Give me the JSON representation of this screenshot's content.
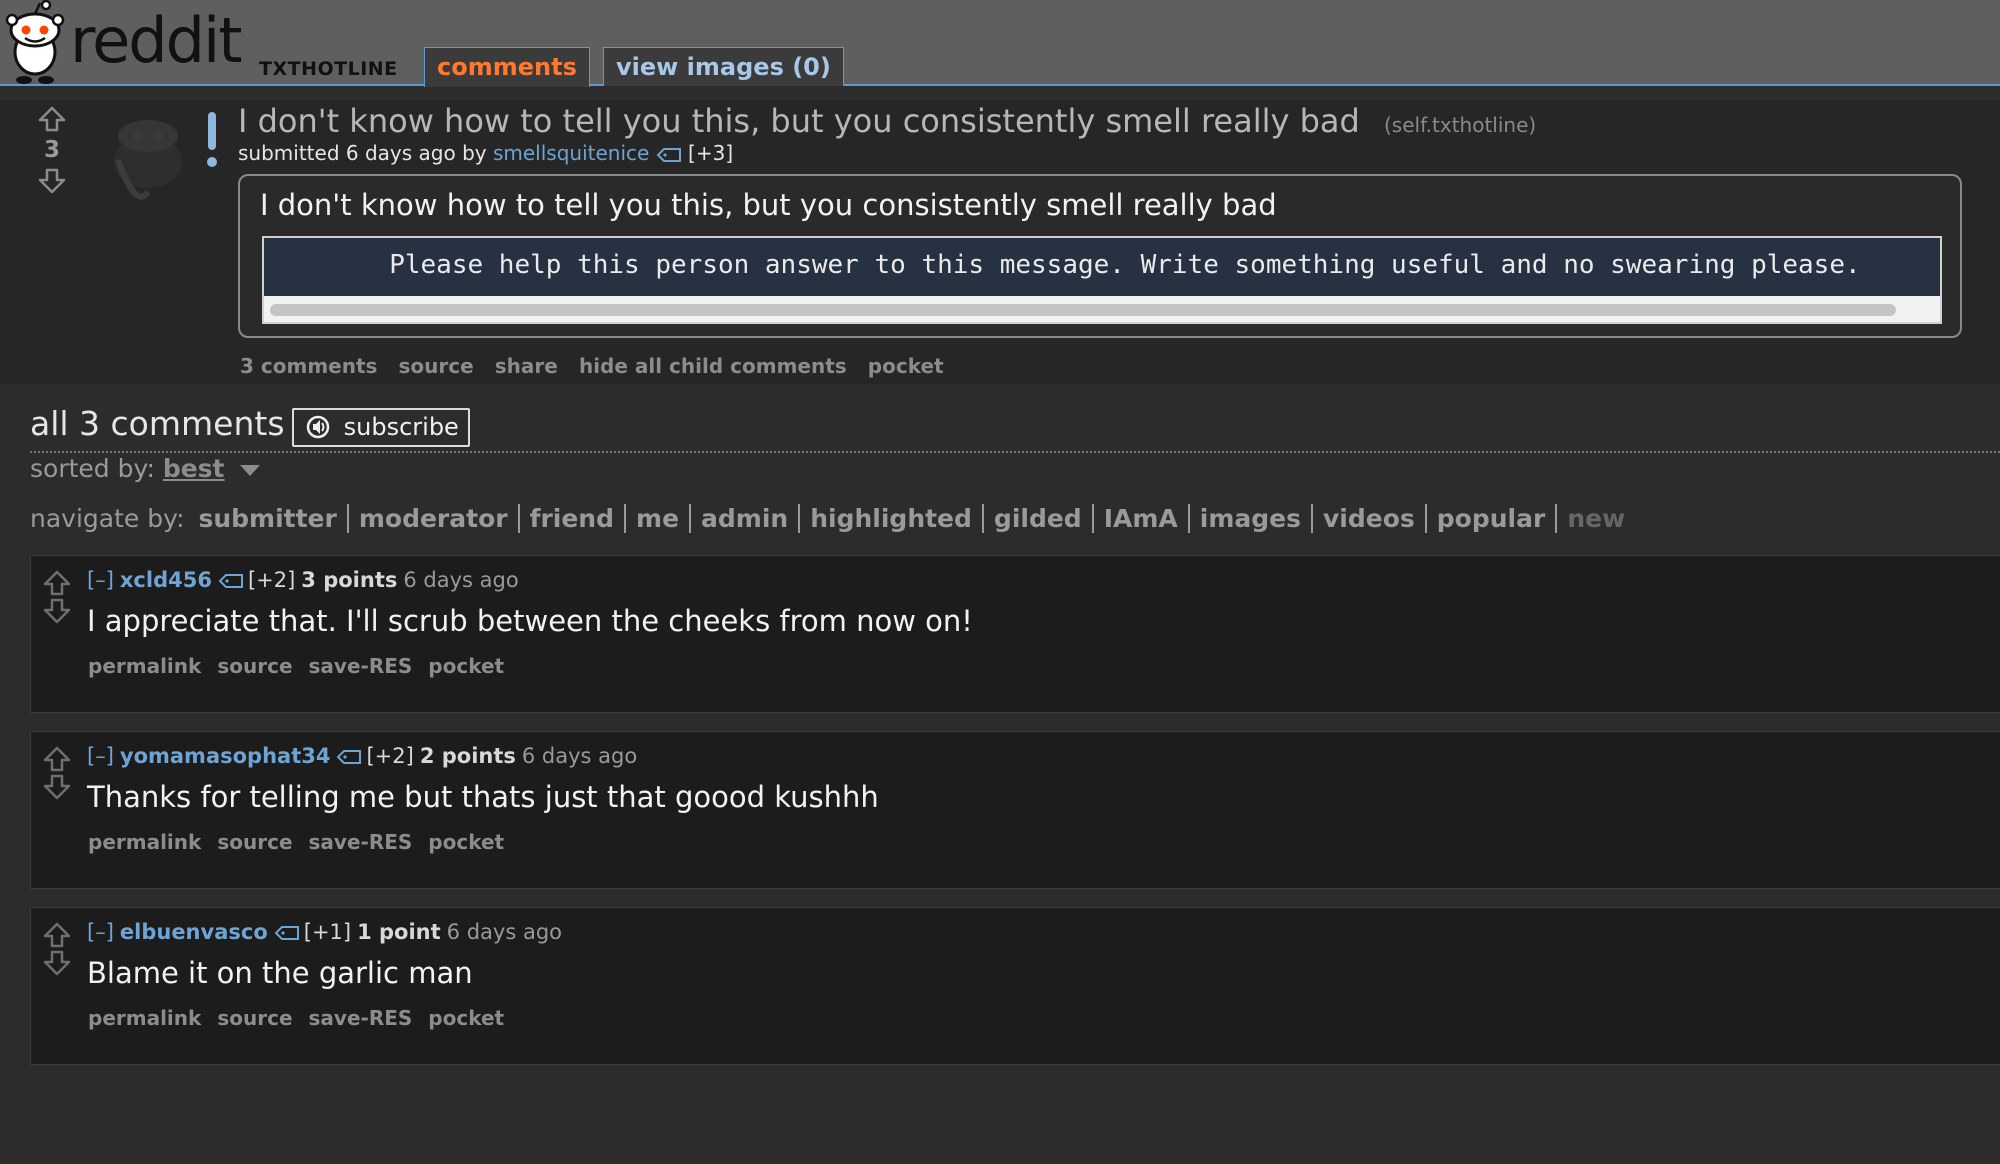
{
  "header": {
    "logo_text": "reddit",
    "subreddit": "TXTHOTLINE",
    "tabs": [
      {
        "label": "comments",
        "selected": true
      },
      {
        "label": "view images (0)",
        "selected": false
      }
    ]
  },
  "post": {
    "score": "3",
    "title": "I don't know how to tell you this, but you consistently smell really bad",
    "domain": "(self.txthotline)",
    "submitted_prefix": "submitted 6 days ago by",
    "author": "smellsquitenice",
    "author_karma": "[+3]",
    "selftext": "I don't know how to tell you this, but you consistently smell really bad",
    "code_text": "        Please help this person answer to this message. Write something useful and no swearing please.",
    "buttons": [
      "3 comments",
      "source",
      "share",
      "hide all child comments",
      "pocket"
    ]
  },
  "comments_area": {
    "title": "all 3 comments",
    "subscribe_label": "subscribe",
    "sorted_by_label": "sorted by:",
    "sort_value": "best",
    "navigate_label": "navigate by:",
    "navigate_items": [
      "submitter",
      "moderator",
      "friend",
      "me",
      "admin",
      "highlighted",
      "gilded",
      "IAmA",
      "images",
      "videos",
      "popular",
      "new"
    ]
  },
  "comments": [
    {
      "collapse": "[–]",
      "author": "xcld456",
      "flair": "[+2]",
      "score": "3 points",
      "time": "6 days ago",
      "body": "I appreciate that. I'll scrub between the cheeks from now on!",
      "buttons": [
        "permalink",
        "source",
        "save-RES",
        "pocket"
      ]
    },
    {
      "collapse": "[–]",
      "author": "yomamasophat34",
      "flair": "[+2]",
      "score": "2 points",
      "time": "6 days ago",
      "body": "Thanks for telling me but thats just that goood kushhh",
      "buttons": [
        "permalink",
        "source",
        "save-RES",
        "pocket"
      ]
    },
    {
      "collapse": "[–]",
      "author": "elbuenvasco",
      "flair": "[+1]",
      "score": "1 point",
      "time": "6 days ago",
      "body": "Blame it on the garlic man",
      "buttons": [
        "permalink",
        "source",
        "save-RES",
        "pocket"
      ]
    }
  ],
  "colors": {
    "header_bg": "#5f5f5f",
    "tab_accent": "#ff7a2d",
    "link_blue": "#6ea4d4",
    "page_bg": "#2c2c2c",
    "comment_bg": "#1c1c1c"
  },
  "icons": [
    "reddit-alien-icon",
    "upvote-arrow-icon",
    "downvote-arrow-icon",
    "user-tag-icon",
    "subscribe-speaker-icon",
    "dropdown-caret-icon"
  ]
}
